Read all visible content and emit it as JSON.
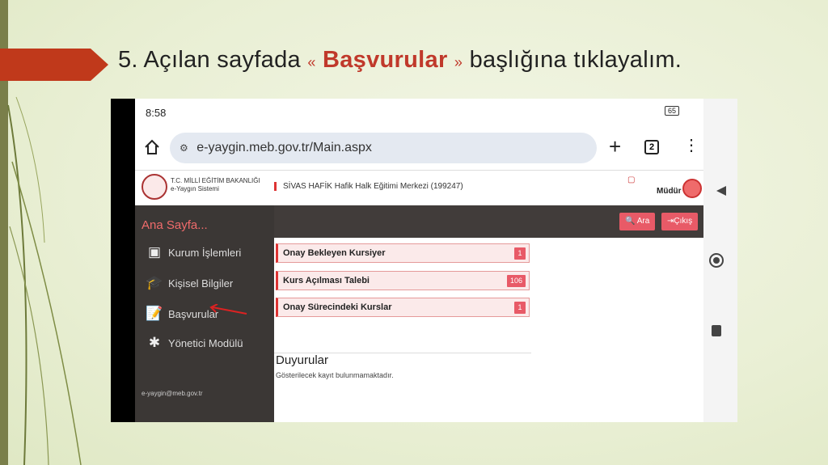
{
  "slide": {
    "title_prefix": "5. Açılan sayfada",
    "quote_open": "«",
    "keyword": "Başvurular",
    "quote_close": "»",
    "title_suffix": "başlığına tıklayalım."
  },
  "phone": {
    "time": "8:58",
    "battery": "65"
  },
  "browser": {
    "url": "e-yaygin.meb.gov.tr/Main.aspx",
    "tab_count": "2"
  },
  "app_header": {
    "brand_line1": "T.C. MİLLİ EĞİTİM BAKANLIĞI",
    "brand_line2": "e-Yaygın Sistemi",
    "institution": "SİVAS HAFİK Hafik Halk Eğitimi Merkezi (199247)",
    "role": "Müdür"
  },
  "sidebar": {
    "title": "Ana Sayfa...",
    "items": [
      {
        "label": "Kurum İşlemleri",
        "icon": "building-icon"
      },
      {
        "label": "Kişisel Bilgiler",
        "icon": "graduation-cap-icon"
      },
      {
        "label": "Başvurular",
        "icon": "document-edit-icon"
      },
      {
        "label": "Yönetici Modülü",
        "icon": "network-icon"
      }
    ],
    "footer_email": "e-yaygin@meb.gov.tr"
  },
  "toolbar": {
    "search_label": "Ara",
    "exit_label": "Çıkış"
  },
  "cards": [
    {
      "label": "Onay Bekleyen Kursiyer",
      "count": "1"
    },
    {
      "label": "Kurs Açılması Talebi",
      "count": "106"
    },
    {
      "label": "Onay Sürecindeki Kurslar",
      "count": "1"
    }
  ],
  "announcements": {
    "title": "Duyurular",
    "text": "Gösterilecek kayıt bulunmamaktadır."
  },
  "colors": {
    "accent": "#e85a67",
    "sidebar_bg": "#3b3735",
    "title_arrow": "#c0391b"
  }
}
